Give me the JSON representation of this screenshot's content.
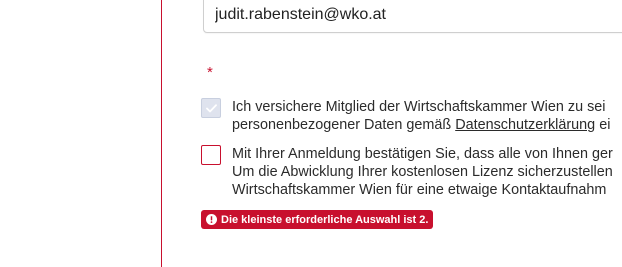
{
  "colors": {
    "accent_red": "#c8102e",
    "checkbox_checked_bg": "#dfe3ee",
    "checkbox_checkmark": "#ffffff"
  },
  "form": {
    "email_value": "judit.rabenstein@wko.at",
    "required_marker": "*",
    "consents": [
      {
        "checked": true,
        "line1": "Ich versichere Mitglied der Wirtschaftskammer Wien zu sei",
        "line2_prefix": "personenbezogener Daten gemäß ",
        "line2_link": "Datenschutzerklärung",
        "line2_suffix": " ei"
      },
      {
        "checked": false,
        "line1": "Mit Ihrer Anmeldung bestätigen Sie, dass alle von Ihnen ger",
        "line2": "Um die Abwicklung Ihrer kostenlosen Lizenz sicherzustellen",
        "line3": "Wirtschaftskammer Wien für eine etwaige Kontaktaufnahm"
      }
    ],
    "error": {
      "icon": "exclamation-circle-icon",
      "message": "Die kleinste erforderliche Auswahl ist 2."
    }
  }
}
